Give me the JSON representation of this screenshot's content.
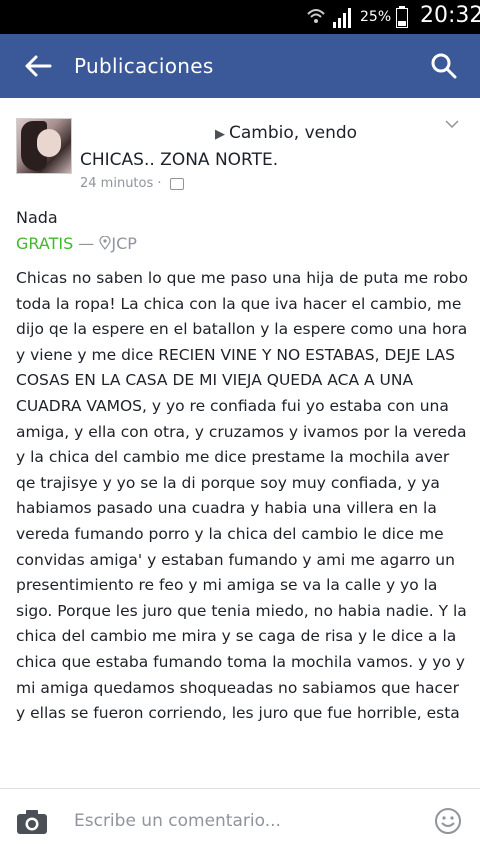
{
  "status_bar": {
    "battery_percent": "25%",
    "time": "20:32"
  },
  "app_bar": {
    "title": "Publicaciones"
  },
  "post": {
    "group_name": "Cambio, vendo",
    "title": "CHICAS.. ZONA NORTE.",
    "time_ago": "24 minutos",
    "separator": " · ",
    "item_name": "Nada",
    "price": "GRATIS",
    "price_dash": " — ",
    "location": "JCP",
    "body": "Chicas no saben lo que me paso una hija de puta me robo toda la ropa! La chica con la que iva hacer el cambio, me dijo qe la espere en el batallon y la espere como una hora y viene y me dice RECIEN VINE Y NO ESTABAS, DEJE LAS COSAS EN LA CASA DE MI VIEJA QUEDA ACA A UNA CUADRA VAMOS, y yo re confiada fui yo estaba con una amiga, y ella con otra, y cruzamos y ivamos por la vereda y la chica del cambio me dice prestame la mochila aver qe trajisye y yo se la di porque soy muy confiada, y ya habiamos pasado una cuadra y habia una villera en la vereda fumando porro y la chica del cambio le dice me convidas amiga' y estaban fumando y ami me agarro un presentimiento re feo y mi amiga se va la calle y yo la sigo. Porque les juro que tenia miedo, no habia nadie. Y la chica del cambio me mira y se caga de risa y le dice a la chica que estaba fumando toma la mochila vamos. y yo y mi amiga quedamos shoqueadas no sabiamos que hacer y ellas se fueron corriendo, les juro que fue horrible, esta"
  },
  "comment_bar": {
    "placeholder": "Escribe un comentario..."
  },
  "colors": {
    "app_bar": "#3b5998",
    "price": "#42b72a",
    "meta": "#90949c"
  },
  "icons": {
    "back": "back-arrow-icon",
    "search": "search-icon",
    "camera": "camera-icon",
    "emoji": "emoji-icon",
    "chevron": "chevron-down-icon",
    "wifi": "wifi-icon",
    "signal": "signal-icon",
    "battery": "battery-icon",
    "location": "location-pin-icon",
    "globe": "audience-icon"
  }
}
